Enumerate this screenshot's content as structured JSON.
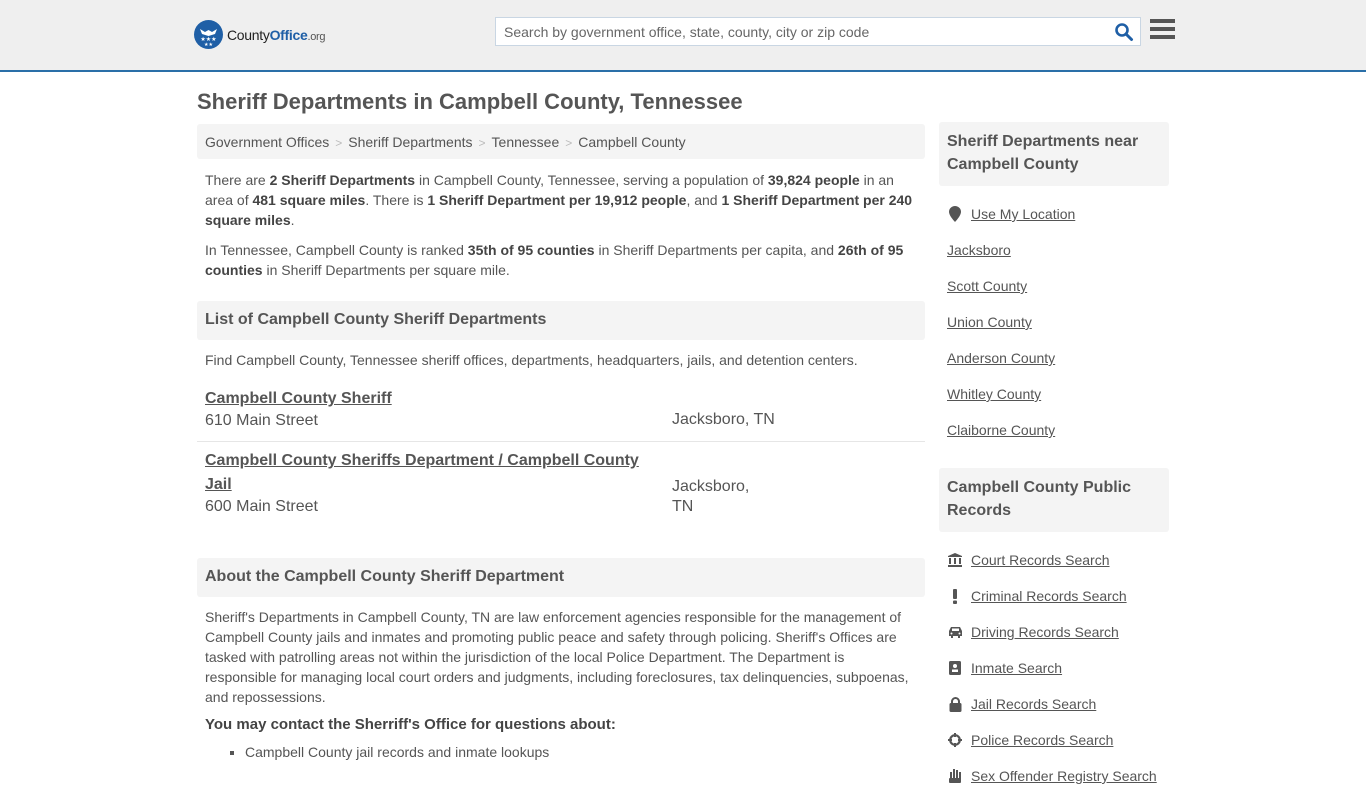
{
  "header": {
    "logo": {
      "name_part1": "County",
      "name_part2": "Office",
      "name_suffix": ".org"
    },
    "search": {
      "placeholder": "Search by government office, state, county, city or zip code",
      "value": ""
    },
    "icons": {
      "search": "search-icon",
      "menu": "hamburger-menu-icon"
    }
  },
  "page": {
    "title": "Sheriff Departments in Campbell County, Tennessee"
  },
  "breadcrumb": [
    {
      "label": "Government Offices"
    },
    {
      "label": "Sheriff Departments"
    },
    {
      "label": "Tennessee"
    },
    {
      "label": "Campbell County"
    }
  ],
  "summary": {
    "p1": {
      "t1": "There are ",
      "b1": "2 Sheriff Departments",
      "t2": " in Campbell County, Tennessee, serving a population of ",
      "b2": "39,824 people",
      "t3": " in an area of ",
      "b3": "481 square miles",
      "t4": ". There is ",
      "b4": "1 Sheriff Department per 19,912 people",
      "t5": ", and ",
      "b5": "1 Sheriff Department per 240 square miles",
      "t6": "."
    },
    "p2": {
      "t1": "In Tennessee, Campbell County is ranked ",
      "b1": "35th of 95 counties",
      "t2": " in Sheriff Departments per capita, and ",
      "b2": "26th of 95 counties",
      "t3": " in Sheriff Departments per square mile."
    }
  },
  "list_section": {
    "heading": "List of Campbell County Sheriff Departments",
    "intro": "Find Campbell County, Tennessee sheriff offices, departments, headquarters, jails, and detention centers.",
    "offices": [
      {
        "name": "Campbell County Sheriff",
        "address": "610 Main Street",
        "city": "Jacksboro, TN"
      },
      {
        "name": "Campbell County Sheriffs Department / Campbell County Jail",
        "address": "600 Main Street",
        "city": "Jacksboro, TN"
      }
    ]
  },
  "about_section": {
    "heading": "About the Campbell County Sheriff Department",
    "body": "Sheriff's Departments in Campbell County, TN are law enforcement agencies responsible for the management of Campbell County jails and inmates and promoting public peace and safety through policing. Sheriff's Offices are tasked with patrolling areas not within the jurisdiction of the local Police Department. The Department is responsible for managing local court orders and judgments, including foreclosures, tax delinquencies, subpoenas, and repossessions.",
    "contact_heading": "You may contact the Sherriff's Office for questions about:",
    "contact_items": [
      "Campbell County jail records and inmate lookups"
    ]
  },
  "sidebar": {
    "nearby": {
      "heading": "Sheriff Departments near Campbell County",
      "use_location": "Use My Location",
      "links": [
        "Jacksboro",
        "Scott County",
        "Union County",
        "Anderson County",
        "Whitley County",
        "Claiborne County"
      ]
    },
    "public_records": {
      "heading": "Campbell County Public Records",
      "links": [
        {
          "label": "Court Records Search",
          "icon": "courthouse-icon"
        },
        {
          "label": "Criminal Records Search",
          "icon": "exclamation-icon"
        },
        {
          "label": "Driving Records Search",
          "icon": "car-icon"
        },
        {
          "label": "Inmate Search",
          "icon": "id-badge-icon"
        },
        {
          "label": "Jail Records Search",
          "icon": "lock-icon"
        },
        {
          "label": "Police Records Search",
          "icon": "crosshairs-icon"
        },
        {
          "label": "Sex Offender Registry Search",
          "icon": "hand-icon"
        }
      ]
    }
  }
}
